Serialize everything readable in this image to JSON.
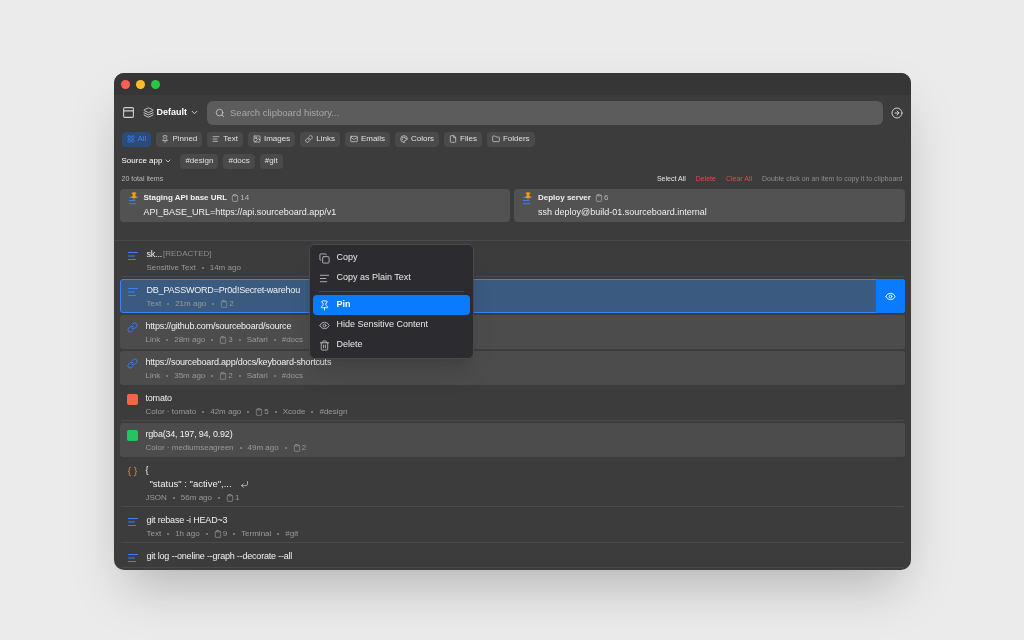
{
  "toolbar": {
    "profile": "Default",
    "search": {
      "placeholder": "Search clipboard history..."
    }
  },
  "filters": [
    {
      "label": "All",
      "selected": true
    },
    {
      "label": "Pinned",
      "selected": false
    },
    {
      "label": "Text",
      "selected": false
    },
    {
      "label": "Images",
      "selected": false
    },
    {
      "label": "Links",
      "selected": false
    },
    {
      "label": "Emails",
      "selected": false
    },
    {
      "label": "Colors",
      "selected": false
    },
    {
      "label": "Files",
      "selected": false
    },
    {
      "label": "Folders",
      "selected": false
    }
  ],
  "source_app": "Source app",
  "tags": [
    "#design",
    "#docs",
    "#git"
  ],
  "summary": {
    "count": "20 total items",
    "select_all": "Select All",
    "delete": "Delete",
    "clear_all": "Clear All",
    "hint": "Double click on an item to copy it to clipboard"
  },
  "pinned": [
    {
      "title": "Staging API base URL",
      "copies": "14",
      "content": "API_BASE_URL=https://api.sourceboard.app/v1"
    },
    {
      "title": "Deploy server",
      "copies": "6",
      "content": "ssh deploy@build-01.sourceboard.internal"
    }
  ],
  "items": [
    {
      "kind": "text",
      "title": "sk...",
      "redacted": "[REDACTED]",
      "selected": false,
      "shaded": false,
      "meta": [
        {
          "kind": "text",
          "text": "Sensitive Text"
        },
        {
          "kind": "text",
          "text": "14m ago"
        }
      ]
    },
    {
      "kind": "text",
      "title": "DB_PASSWORD=Pr0d!Secret-warehou",
      "selected": true,
      "shaded": true,
      "meta": [
        {
          "kind": "text",
          "text": "Text"
        },
        {
          "kind": "text",
          "text": "21m ago"
        },
        {
          "kind": "count",
          "text": "2"
        }
      ]
    },
    {
      "kind": "link",
      "title": "https://github.com/sourceboard/source",
      "selected": false,
      "shaded": true,
      "meta": [
        {
          "kind": "text",
          "text": "Link"
        },
        {
          "kind": "text",
          "text": "28m ago"
        },
        {
          "kind": "count",
          "text": "3"
        },
        {
          "kind": "text",
          "text": "Safari"
        },
        {
          "kind": "text",
          "text": "#docs"
        }
      ]
    },
    {
      "kind": "link",
      "title": "https://sourceboard.app/docs/keyboard-shortcuts",
      "selected": false,
      "shaded": true,
      "meta": [
        {
          "kind": "text",
          "text": "Link"
        },
        {
          "kind": "text",
          "text": "35m ago"
        },
        {
          "kind": "count",
          "text": "2"
        },
        {
          "kind": "text",
          "text": "Safari"
        },
        {
          "kind": "text",
          "text": "#docs"
        }
      ]
    },
    {
      "kind": "color",
      "color": "#f26549",
      "title": "tomato",
      "selected": false,
      "shaded": false,
      "meta": [
        {
          "kind": "text",
          "text": "Color · tomato"
        },
        {
          "kind": "text",
          "text": "42m ago"
        },
        {
          "kind": "count",
          "text": "5"
        },
        {
          "kind": "text",
          "text": "Xcode"
        },
        {
          "kind": "text",
          "text": "#design"
        }
      ]
    },
    {
      "kind": "color",
      "color": "#22c55e",
      "title": "rgba(34, 197, 94, 0.92)",
      "selected": false,
      "shaded": true,
      "meta": [
        {
          "kind": "text",
          "text": "Color · mediumseagreen"
        },
        {
          "kind": "text",
          "text": "49m ago"
        },
        {
          "kind": "count",
          "text": "2"
        }
      ]
    },
    {
      "kind": "json",
      "title": "{",
      "second_line": "\"status\" : \"active\",...",
      "selected": false,
      "shaded": false,
      "meta": [
        {
          "kind": "text",
          "text": "JSON"
        },
        {
          "kind": "text",
          "text": "56m ago"
        },
        {
          "kind": "count",
          "text": "1"
        }
      ]
    },
    {
      "kind": "text",
      "title": "git rebase -i HEAD~3",
      "selected": false,
      "shaded": false,
      "meta": [
        {
          "kind": "text",
          "text": "Text"
        },
        {
          "kind": "text",
          "text": "1h ago"
        },
        {
          "kind": "count",
          "text": "9"
        },
        {
          "kind": "text",
          "text": "Terminal"
        },
        {
          "kind": "text",
          "text": "#git"
        }
      ]
    },
    {
      "kind": "text",
      "title": "git log --oneline --graph --decorate --all",
      "selected": false,
      "shaded": false
    }
  ],
  "context_menu": [
    {
      "kind": "item",
      "label": "Copy",
      "selected": false
    },
    {
      "kind": "item",
      "label": "Copy as Plain Text",
      "selected": false
    },
    {
      "kind": "separator"
    },
    {
      "kind": "item",
      "label": "Pin",
      "selected": true
    },
    {
      "kind": "item",
      "label": "Hide Sensitive Content",
      "selected": false
    },
    {
      "kind": "item",
      "label": "Delete",
      "selected": false
    }
  ]
}
